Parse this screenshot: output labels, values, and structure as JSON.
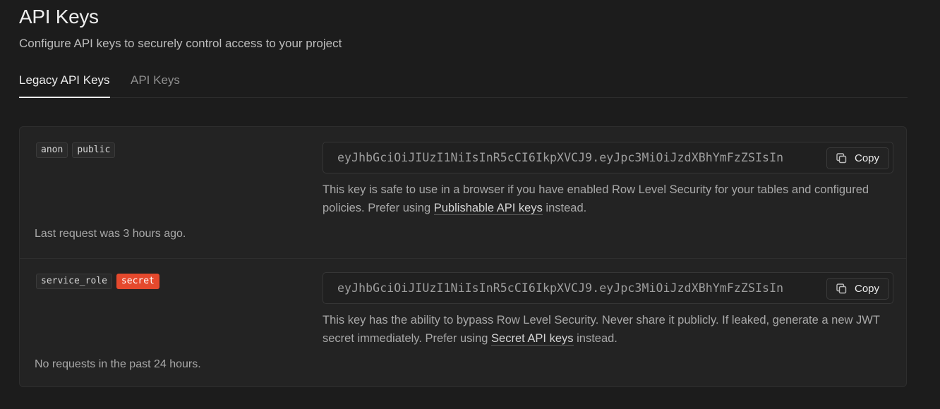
{
  "header": {
    "title": "API Keys",
    "subtitle": "Configure API keys to securely control access to your project"
  },
  "tabs": [
    {
      "label": "Legacy API Keys",
      "active": true
    },
    {
      "label": "API Keys",
      "active": false
    }
  ],
  "keys": [
    {
      "badges": [
        "anon",
        "public"
      ],
      "value": "eyJhbGciOiJIUzI1NiIsInR5cCI6IkpXVCJ9.eyJpc3MiOiJzdXBhYmFzZSIsIn",
      "copy_label": "Copy",
      "desc_before": "This key is safe to use in a browser if you have enabled Row Level Security for your tables and configured policies. Prefer using ",
      "desc_link": "Publishable API keys",
      "desc_after": " instead.",
      "last_request": "Last request was 3 hours ago."
    },
    {
      "badges": [
        "service_role",
        "secret"
      ],
      "value": "eyJhbGciOiJIUzI1NiIsInR5cCI6IkpXVCJ9.eyJpc3MiOiJzdXBhYmFzZSIsIn",
      "copy_label": "Copy",
      "desc_before": "This key has the ability to bypass Row Level Security. Never share it publicly. If leaked, generate a new JWT secret immediately. Prefer using ",
      "desc_link": "Secret API keys",
      "desc_after": " instead.",
      "last_request": "No requests in the past 24 hours."
    }
  ],
  "icons": {
    "copy": "copy-icon"
  },
  "colors": {
    "background": "#1c1c1c",
    "panel": "#232323",
    "danger_badge": "#e5492d"
  }
}
